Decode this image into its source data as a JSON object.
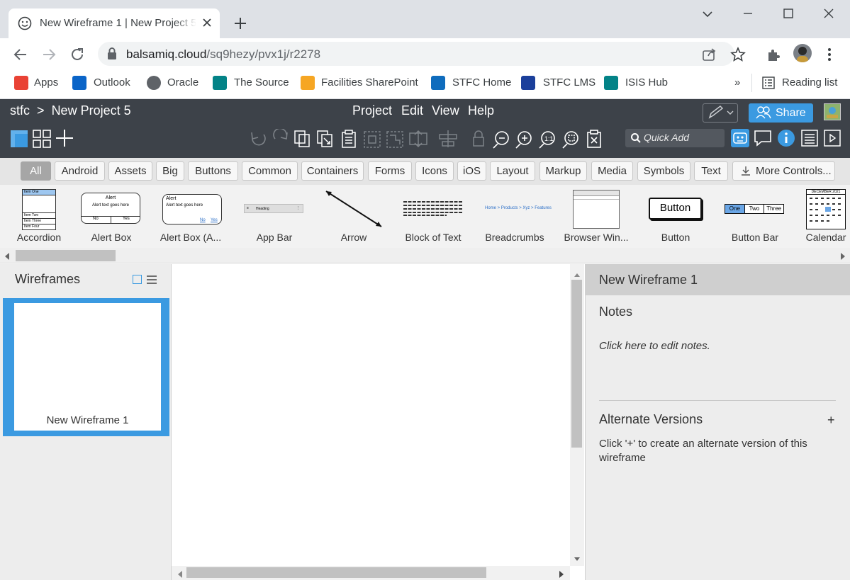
{
  "browser": {
    "tab_title": "New Wireframe 1 | New Project 5",
    "url_host": "balsamiq.cloud",
    "url_path": "/sq9hezy/pvx1j/r2278",
    "bookmarks": [
      {
        "label": "Apps",
        "icon": "apps-grid-icon",
        "color": "#e94235"
      },
      {
        "label": "Outlook",
        "icon": "outlook-icon",
        "color": "#0a64c8"
      },
      {
        "label": "Oracle",
        "icon": "globe-icon",
        "color": "#5f6368"
      },
      {
        "label": "The Source",
        "icon": "sharepoint-icon",
        "color": "#038387"
      },
      {
        "label": "Facilities SharePoint",
        "icon": "facilities-icon",
        "color": "#f6a623"
      },
      {
        "label": "STFC Home",
        "icon": "sharepoint-icon",
        "color": "#0f6cbd"
      },
      {
        "label": "STFC LMS",
        "icon": "lms-icon",
        "color": "#1b3f9b"
      },
      {
        "label": "ISIS Hub",
        "icon": "sharepoint-icon",
        "color": "#038387"
      }
    ],
    "more_bookmarks": "»",
    "reading_list": "Reading list"
  },
  "app": {
    "breadcrumb_org": "stfc",
    "breadcrumb_sep": ">",
    "breadcrumb_project": "New Project 5",
    "menu": [
      "Project",
      "Edit",
      "View",
      "Help"
    ],
    "share_label": "Share",
    "quick_add_placeholder": "Quick Add",
    "accent": "#3b9ae1"
  },
  "filters": [
    "All",
    "Android",
    "Assets",
    "Big",
    "Buttons",
    "Common",
    "Containers",
    "Forms",
    "Icons",
    "iOS",
    "Layout",
    "Markup",
    "Media",
    "Symbols",
    "Text"
  ],
  "more_controls": "More Controls...",
  "library": [
    {
      "label": "Accordion"
    },
    {
      "label": "Alert Box"
    },
    {
      "label": "Alert Box (A..."
    },
    {
      "label": "App Bar"
    },
    {
      "label": "Arrow"
    },
    {
      "label": "Block of Text"
    },
    {
      "label": "Breadcrumbs"
    },
    {
      "label": "Browser Win..."
    },
    {
      "label": "Button"
    },
    {
      "label": "Button Bar"
    },
    {
      "label": "Calendar"
    }
  ],
  "thumb_text": {
    "accordion": [
      "Item One",
      "Item Two",
      "Item Three",
      "Item Four"
    ],
    "alert_title": "Alert",
    "alert_body": "Alert text goes here",
    "alert_no": "No",
    "alert_yes": "Yes",
    "appbar_heading": "Heading",
    "breadcrumbs": "Home > Products > Xyz > Features",
    "button": "Button",
    "buttonbar": [
      "One",
      "Two",
      "Three"
    ],
    "calendar_month": "DECEMBER 2021"
  },
  "wireframes_panel": {
    "title": "Wireframes",
    "items": [
      {
        "label": "New Wireframe 1"
      }
    ]
  },
  "inspector": {
    "title": "New Wireframe 1",
    "notes_heading": "Notes",
    "notes_placeholder": "Click here to edit notes.",
    "alt_heading": "Alternate Versions",
    "alt_add": "+",
    "alt_hint": "Click '+' to create an alternate version of this wireframe"
  }
}
